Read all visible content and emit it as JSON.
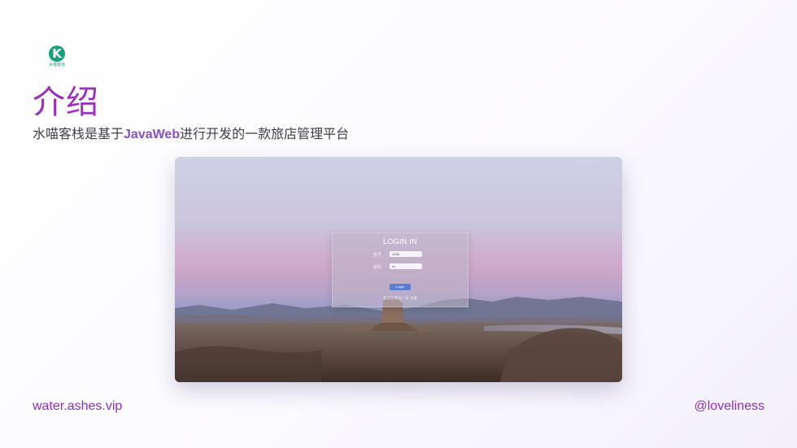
{
  "logo": {
    "mark": "K",
    "text": "水喵客栈"
  },
  "slide": {
    "title": "介绍",
    "subtitle_prefix": "水喵客栈是基于",
    "subtitle_highlight": "JavaWeb",
    "subtitle_suffix": "进行开发的一款旅店管理平台"
  },
  "login": {
    "title": "LOGIN IN",
    "account_label": "账号",
    "account_value": "1234",
    "password_label": "密码",
    "password_value": "•••",
    "login_button": "Login",
    "register_text": "还没有账号？去 注册"
  },
  "footer": {
    "left": "water.ashes.vip",
    "right": "@loveliness"
  },
  "colors": {
    "accent": "#9b2fbf",
    "highlight": "#8a4fc9",
    "logo_green": "#16a27c"
  }
}
